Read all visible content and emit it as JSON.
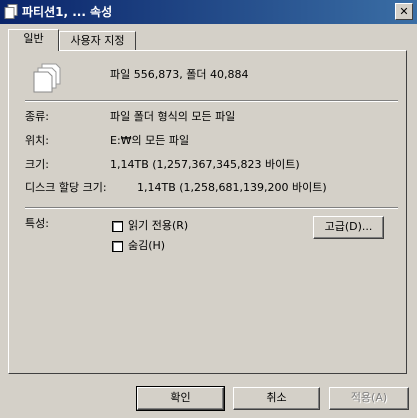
{
  "window": {
    "title": "파티션1, ... 속성",
    "close_glyph": "✕"
  },
  "tabs": [
    {
      "label": "일반",
      "selected": true
    },
    {
      "label": "사용자 지정",
      "selected": false
    }
  ],
  "summary": {
    "icon": "multiple-files-icon",
    "text": "파일 556,873, 폴더 40,884"
  },
  "properties": [
    {
      "label": "종류:",
      "value": "파일 폴더 형식의 모든 파일"
    },
    {
      "label": "위치:",
      "value": "E:₩의 모든 파일"
    },
    {
      "label": "크기:",
      "value": "1,14TB (1,257,367,345,823 바이트)"
    },
    {
      "label": "디스크 할당 크기:",
      "value": "1,14TB (1,258,681,139,200 바이트)"
    }
  ],
  "attributes": {
    "label": "특성:",
    "read_only": {
      "label": "읽기 전용(R)",
      "checked": false
    },
    "hidden": {
      "label": "숨김(H)",
      "checked": false
    },
    "advanced_button": "고급(D)..."
  },
  "footer": {
    "ok": "확인",
    "cancel": "취소",
    "apply": "적용(A)",
    "apply_enabled": false
  }
}
